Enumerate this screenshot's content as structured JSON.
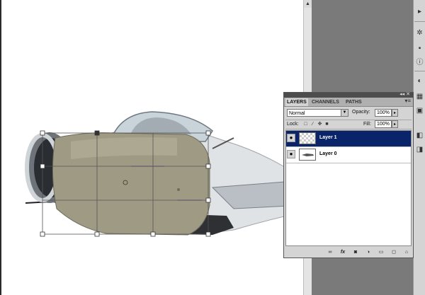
{
  "layers_panel": {
    "tabs": [
      {
        "label": "LAYERS",
        "active": true
      },
      {
        "label": "CHANNELS",
        "active": false
      },
      {
        "label": "PATHS",
        "active": false
      }
    ],
    "titlebar_controls": "◂◂ ✕",
    "menu_icon": "▾≡",
    "blend_mode": "Normal",
    "opacity_label": "Opacity:",
    "opacity_value": "100%",
    "lock_label": "Lock:",
    "fill_label": "Fill:",
    "fill_value": "100%",
    "layers": [
      {
        "name": "Layer 1",
        "selected": true,
        "thumb": "transparent"
      },
      {
        "name": "Layer 0",
        "selected": false,
        "thumb": "plane"
      }
    ],
    "bottom_icons": [
      "link-icon",
      "fx-icon",
      "mask-icon",
      "adjustment-icon",
      "group-icon",
      "new-layer-icon",
      "trash-icon"
    ],
    "fx_label": "fx"
  },
  "colors": {
    "selection": "#0a246a",
    "panel_bg": "#d4d4d4",
    "workspace": "#7a7a7a"
  }
}
